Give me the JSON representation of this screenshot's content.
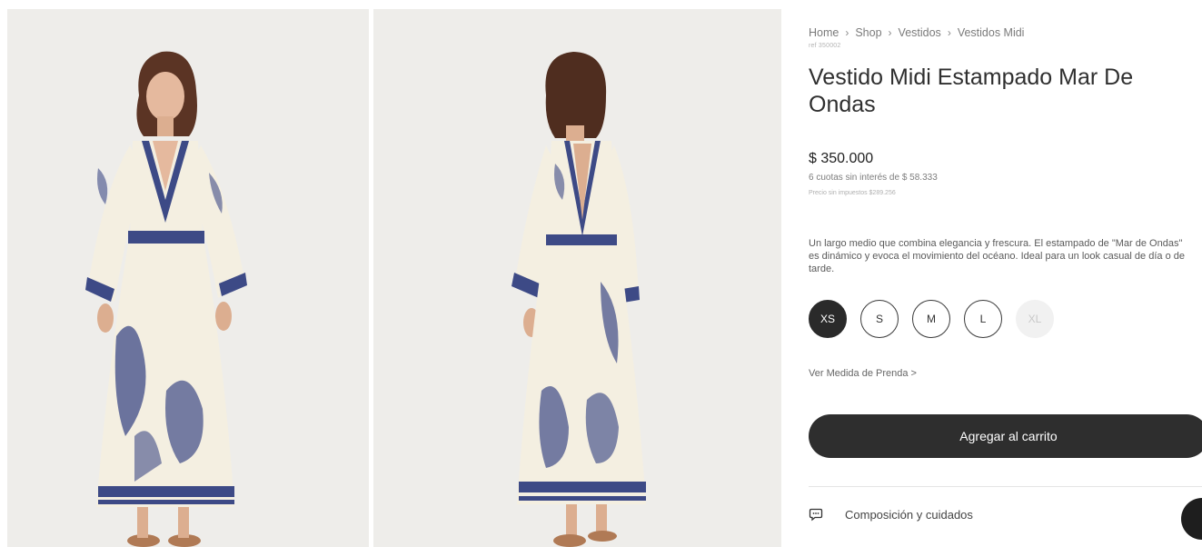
{
  "breadcrumb": {
    "items": [
      "Home",
      "Shop",
      "Vestidos",
      "Vestidos Midi"
    ],
    "separator": "›"
  },
  "product": {
    "reference": "ref 350002",
    "title": "Vestido Midi Estampado Mar De Ondas",
    "price": "$ 350.000",
    "installments": "6 cuotas sin interés de $ 58.333",
    "price_without_tax": "Precio sin impuestos $289.256",
    "description": "Un largo medio que combina elegancia y frescura. El estampado de \"Mar de Ondas\" es dinámico y evoca el movimiento del océano. Ideal para un look casual de día o de tarde."
  },
  "sizes": {
    "options": [
      "XS",
      "S",
      "M",
      "L",
      "XL"
    ],
    "selected": "XS",
    "unavailable": [
      "XL"
    ]
  },
  "size_guide_link": "Ver Medida de Prenda >",
  "cart_button_label": "Agregar al carrito",
  "accordion": {
    "label": "Composición y cuidados",
    "icon": "chat-bubble-icon"
  },
  "gallery": {
    "images": [
      "front-view-photo",
      "back-view-photo"
    ]
  },
  "colors": {
    "accent_dark": "#2e2e2e",
    "dress_cream": "#f4efe1",
    "print_navy": "#3d4a86",
    "photo_background": "#eeedea"
  }
}
